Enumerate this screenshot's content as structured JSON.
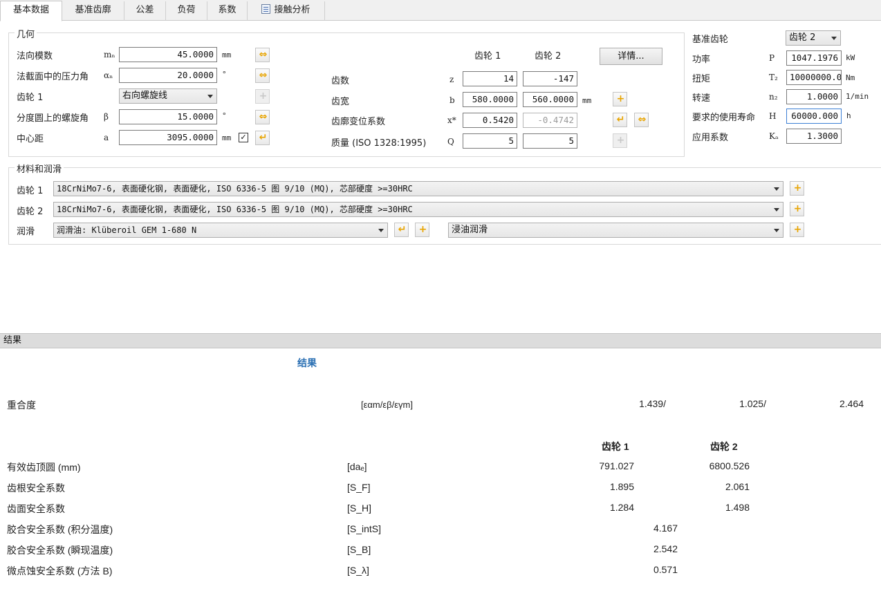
{
  "tabs": [
    "基本数据",
    "基准齿廓",
    "公差",
    "负荷",
    "系数",
    "接触分析"
  ],
  "geometry": {
    "title": "几何",
    "normal_module": {
      "label": "法向模数",
      "sym": "mₙ",
      "value": "45.0000",
      "unit": "mm"
    },
    "pressure_angle": {
      "label": "法截面中的压力角",
      "sym": "αₙ",
      "value": "20.0000",
      "unit": "°"
    },
    "gear1_helix": {
      "label": "齿轮 1",
      "value": "右向螺旋线"
    },
    "helix_angle": {
      "label": "分度圆上的螺旋角",
      "sym": "β",
      "value": "15.0000",
      "unit": "°"
    },
    "center_distance": {
      "label": "中心距",
      "sym": "a",
      "value": "3095.0000",
      "unit": "mm",
      "checked": "✓"
    },
    "col_gear1": "齿轮 1",
    "col_gear2": "齿轮 2",
    "details_button": "详情...",
    "teeth": {
      "label": "齿数",
      "sym": "z",
      "g1": "14",
      "g2": "-147"
    },
    "face_width": {
      "label": "齿宽",
      "sym": "b",
      "g1": "580.0000",
      "g2": "560.0000",
      "unit": "mm"
    },
    "profile_shift": {
      "label": "齿廓变位系数",
      "sym": "x*",
      "g1": "0.5420",
      "g2": "-0.4742"
    },
    "quality": {
      "label": "质量 (ISO 1328:1995)",
      "sym": "Q",
      "g1": "5",
      "g2": "5"
    }
  },
  "reference": {
    "ref_gear": {
      "label": "基准齿轮",
      "value": "齿轮 2"
    },
    "power": {
      "label": "功率",
      "sym": "P",
      "value": "1047.1976",
      "unit": "kW"
    },
    "torque": {
      "label": "扭矩",
      "sym": "T₂",
      "value": "10000000.0",
      "unit": "Nm"
    },
    "speed": {
      "label": "转速",
      "sym": "n₂",
      "value": "1.0000",
      "unit": "1/min"
    },
    "life": {
      "label": "要求的使用寿命",
      "sym": "H",
      "value": "60000.000",
      "unit": "h"
    },
    "application": {
      "label": "应用系数",
      "sym": "Kₐ",
      "value": "1.3000"
    }
  },
  "materials": {
    "title": "材料和润滑",
    "gear1": {
      "label": "齿轮 1",
      "value": "18CrNiMo7-6, 表面硬化钢, 表面硬化, ISO 6336-5 图 9/10 (MQ), 芯部硬度 >=30HRC"
    },
    "gear2": {
      "label": "齿轮 2",
      "value": "18CrNiMo7-6, 表面硬化钢, 表面硬化, ISO 6336-5 图 9/10 (MQ), 芯部硬度 >=30HRC"
    },
    "lubrication": {
      "label": "润滑",
      "oil": "润滑油: Klüberoil GEM 1-680 N",
      "method": "浸油润滑"
    }
  },
  "results": {
    "header": "结果",
    "title": "结果",
    "contact_ratio": {
      "label": "重合度",
      "sym": "[εαm/εβ/εγm]",
      "v1": "1.439/",
      "v2": "1.025/",
      "v3": "2.464"
    },
    "col_gear1": "齿轮 1",
    "col_gear2": "齿轮 2",
    "rows": [
      {
        "label": "有效齿顶圆 (mm)",
        "sym": "[daₑ]",
        "g1": "791.027",
        "g2": "6800.526"
      },
      {
        "label": "齿根安全系数",
        "sym": "[S_F]",
        "g1": "1.895",
        "g2": "2.061"
      },
      {
        "label": "齿面安全系数",
        "sym": "[S_H]",
        "g1": "1.284",
        "g2": "1.498"
      }
    ],
    "single_rows": [
      {
        "label": "胶合安全系数 (积分温度)",
        "sym": "[S_intS]",
        "value": "4.167"
      },
      {
        "label": "胶合安全系数 (瞬现温度)",
        "sym": "[S_B]",
        "value": "2.542"
      },
      {
        "label": "微点蚀安全系数 (方法 B)",
        "sym": "[S_λ]",
        "value": "0.571"
      }
    ]
  }
}
